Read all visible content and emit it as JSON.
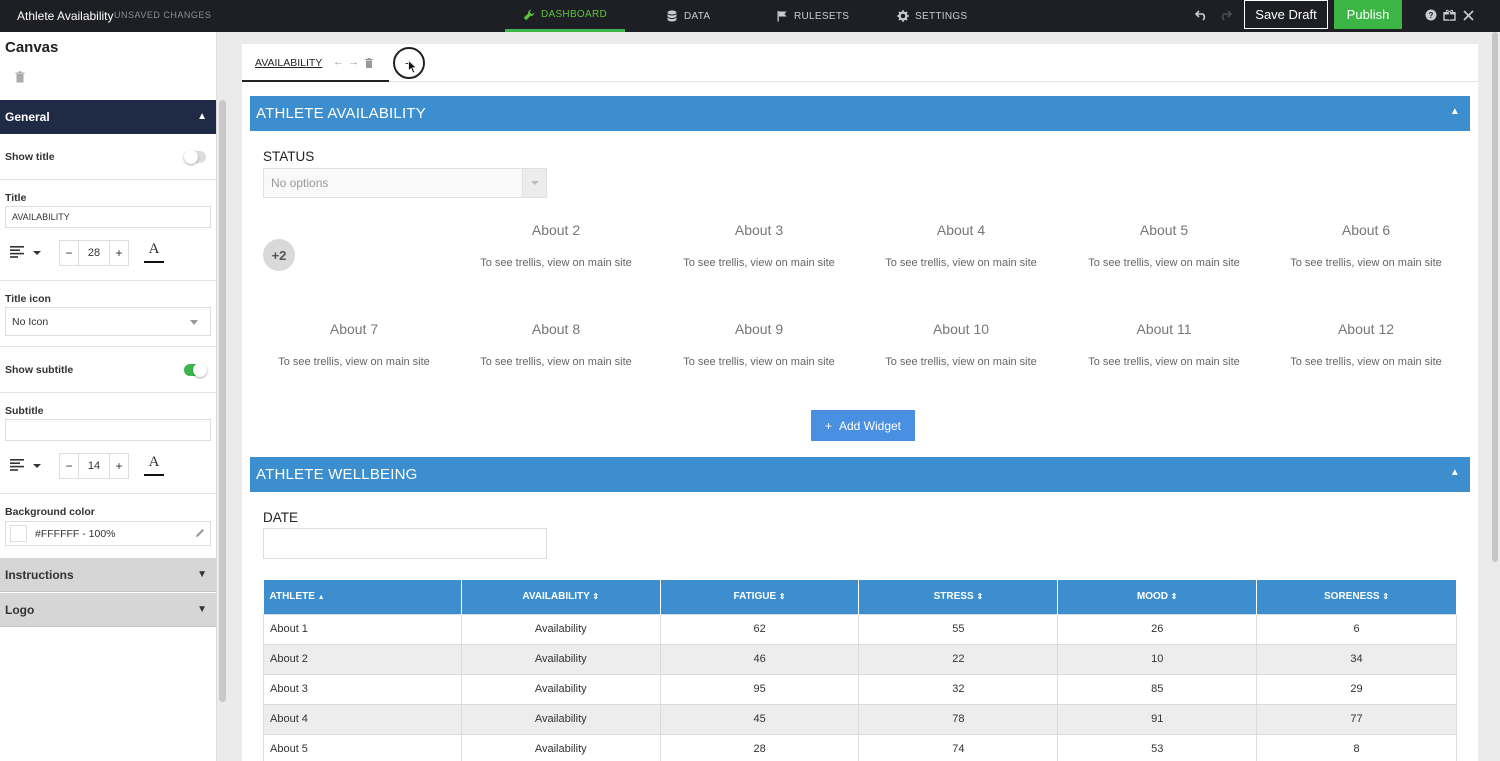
{
  "topbar": {
    "app_title": "Athlete Availability",
    "unsaved": "UNSAVED CHANGES",
    "nav": [
      {
        "label": "DASHBOARD",
        "icon": "wrench-icon",
        "active": true
      },
      {
        "label": "DATA",
        "icon": "database-icon",
        "active": false
      },
      {
        "label": "RULESETS",
        "icon": "flag-icon",
        "active": false
      },
      {
        "label": "SETTINGS",
        "icon": "gear-icon",
        "active": false
      }
    ],
    "save_draft": "Save Draft",
    "publish": "Publish",
    "colors": {
      "bar": "#1e1f24",
      "active": "#5cc341",
      "publish": "#3bb543"
    }
  },
  "sidebar": {
    "heading": "Canvas",
    "general": "General",
    "show_title": "Show title",
    "title_label": "Title",
    "title_value": "AVAILABILITY",
    "title_font_size": "28",
    "title_icon_label": "Title icon",
    "title_icon_value": "No Icon",
    "show_subtitle": "Show subtitle",
    "subtitle_label": "Subtitle",
    "subtitle_value": "",
    "subtitle_font_size": "14",
    "bg_label": "Background color",
    "bg_value": "#FFFFFF - 100%",
    "instructions": "Instructions",
    "logo": "Logo",
    "show_title_on": false,
    "show_subtitle_on": true
  },
  "canvas": {
    "tab_label": "AVAILABILITY",
    "section1": {
      "title": "ATHLETE AVAILABILITY",
      "status_label": "STATUS",
      "status_placeholder": "No options",
      "more_badge": "+2",
      "trellis": [
        {
          "title": "About 2",
          "note": "To see trellis, view on main site"
        },
        {
          "title": "About 3",
          "note": "To see trellis, view on main site"
        },
        {
          "title": "About 4",
          "note": "To see trellis, view on main site"
        },
        {
          "title": "About 5",
          "note": "To see trellis, view on main site"
        },
        {
          "title": "About 6",
          "note": "To see trellis, view on main site"
        },
        {
          "title": "About 7",
          "note": "To see trellis, view on main site"
        },
        {
          "title": "About 8",
          "note": "To see trellis, view on main site"
        },
        {
          "title": "About 9",
          "note": "To see trellis, view on main site"
        },
        {
          "title": "About 10",
          "note": "To see trellis, view on main site"
        },
        {
          "title": "About 11",
          "note": "To see trellis, view on main site"
        },
        {
          "title": "About 12",
          "note": "To see trellis, view on main site"
        }
      ],
      "add_widget": "Add Widget"
    },
    "section2": {
      "title": "ATHLETE WELLBEING",
      "date_label": "DATE",
      "table": {
        "headers": [
          {
            "label": "ATHLETE",
            "sort": "▲"
          },
          {
            "label": "AVAILABILITY",
            "sort": "⇕"
          },
          {
            "label": "FATIGUE",
            "sort": "⇕"
          },
          {
            "label": "STRESS",
            "sort": "⇕"
          },
          {
            "label": "MOOD",
            "sort": "⇕"
          },
          {
            "label": "SORENESS",
            "sort": "⇕"
          }
        ],
        "rows": [
          [
            "About 1",
            "Availability",
            "62",
            "55",
            "26",
            "6"
          ],
          [
            "About 2",
            "Availability",
            "46",
            "22",
            "10",
            "34"
          ],
          [
            "About 3",
            "Availability",
            "95",
            "32",
            "85",
            "29"
          ],
          [
            "About 4",
            "Availability",
            "45",
            "78",
            "91",
            "77"
          ],
          [
            "About 5",
            "Availability",
            "28",
            "74",
            "53",
            "8"
          ]
        ]
      }
    },
    "colors": {
      "section_bar": "#3c8ece",
      "add_widget": "#4a90e2"
    }
  }
}
